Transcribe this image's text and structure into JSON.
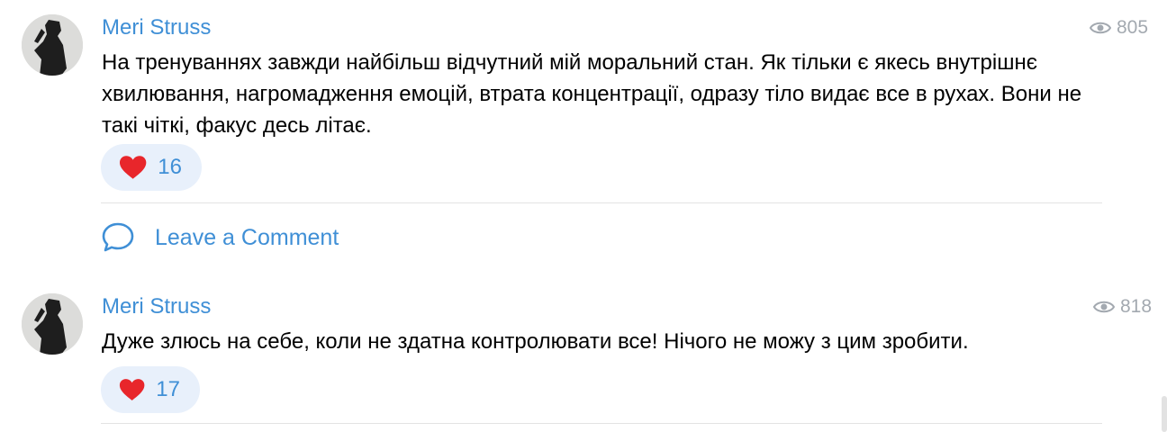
{
  "posts": [
    {
      "author": "Meri Struss",
      "views": "805",
      "text": "На тренуваннях завжди найбільш відчутний мій моральний стан. Як тільки є якесь внутрішнє хвилювання, нагромадження емоцій, втрата концентрації, одразу тіло видає все в рухах. Вони не такі чіткі, факус десь літає.",
      "reaction_icon": "heart-emoji",
      "reaction_count": "16"
    },
    {
      "author": "Meri Struss",
      "views": "818",
      "text": "Дуже злюсь на себе, коли не здатна контролювати все! Нічого не можу з цим зробити.",
      "reaction_icon": "heart-emoji",
      "reaction_count": "17"
    }
  ],
  "comment_action": {
    "label": "Leave a Comment",
    "icon": "speech-bubble-icon"
  },
  "colors": {
    "accent": "#3f8fd6",
    "reaction_bg": "#e8f0fb",
    "heart": "#e8262b",
    "muted": "#a3a9b0"
  }
}
